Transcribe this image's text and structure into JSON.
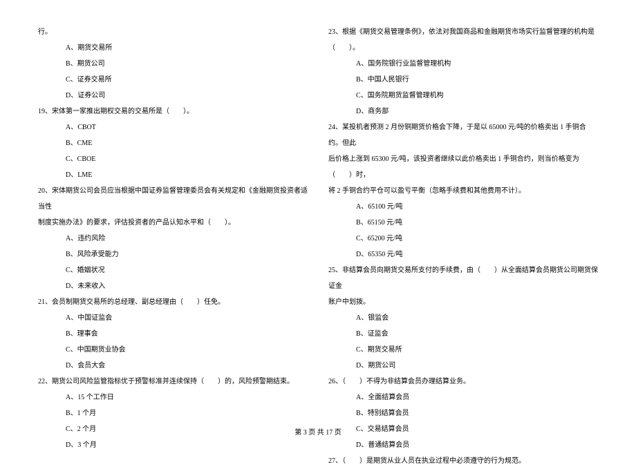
{
  "leftColumn": {
    "topLine": "行。",
    "q18_options": {
      "a": "A、期货交易所",
      "b": "B、期货公司",
      "c": "C、证券交易所",
      "d": "D、证券公司"
    },
    "q19": {
      "text": "19、宋体第一家推出期权交易的交易所是（　　）。",
      "a": "A、CBOT",
      "b": "B、CME",
      "c": "C、CBOE",
      "d": "D、LME"
    },
    "q20": {
      "text1": "20、宋体期货公司会员应当根据中国证券监督管理委员会有关规定和《金融期货投资者适当性",
      "text2": "制度实施办法》的要求，评估投资者的产品认知水平和（　　）。",
      "a": "A、违约风险",
      "b": "B、风险承受能力",
      "c": "C、婚姻状况",
      "d": "D、未来收入"
    },
    "q21": {
      "text": "21、会员制期货交易所的总经理、副总经理由（　　）任免。",
      "a": "A、中国证监会",
      "b": "B、理事会",
      "c": "C、中国期货业协会",
      "d": "D、会员大会"
    },
    "q22": {
      "text": "22、期货公司风险监管指标优于预警标准并连续保持（　　）的，风险预警期结束。",
      "a": "A、15 个工作日",
      "b": "B、1 个月",
      "c": "C、2 个月",
      "d": "D、3 个月"
    }
  },
  "rightColumn": {
    "q23": {
      "text1": "23、根据《期货交易管理条例》，依法对我国商品和金融期货市场实行监督管理的机构是",
      "text2": "（　　）。",
      "a": "A、国务院银行业监督管理机构",
      "b": "B、中国人民银行",
      "c": "C、国务院期货监督管理机构",
      "d": "D、商务部"
    },
    "q24": {
      "text1": "24、某投机者预测 2 月份铜期货价格会下降，于是以 65000 元/吨的价格卖出 1 手铜合约。但此",
      "text2": "后价格上涨到 65300 元/吨，该投资者继续以此价格卖出 1 手铜合约，则当价格变为（　　）时，",
      "text3": "将 2 手铜合约平仓可以盈亏平衡（忽略手续费和其他费用不计）。",
      "a": "A、65100 元/吨",
      "b": "B、65150 元/吨",
      "c": "C、65200 元/吨",
      "d": "D、65350 元/吨"
    },
    "q25": {
      "text1": "25、非结算会员向期货交易所支付的手续费，由（　　）从全面结算会员期货公司期货保证金",
      "text2": "账户中划拨。",
      "a": "A、银监会",
      "b": "B、证监会",
      "c": "C、期货交易所",
      "d": "D、期货公司"
    },
    "q26": {
      "text": "26、（　　）不得为非结算会员办理结算业务。",
      "a": "A、全面结算会员",
      "b": "B、特别结算会员",
      "c": "C、交易结算会员",
      "d": "D、普通结算会员"
    },
    "q27": {
      "text": "27、（　　）是期货从业人员在执业过程中必须遵守的行为规范。"
    }
  },
  "footer": "第 3 页 共 17 页"
}
